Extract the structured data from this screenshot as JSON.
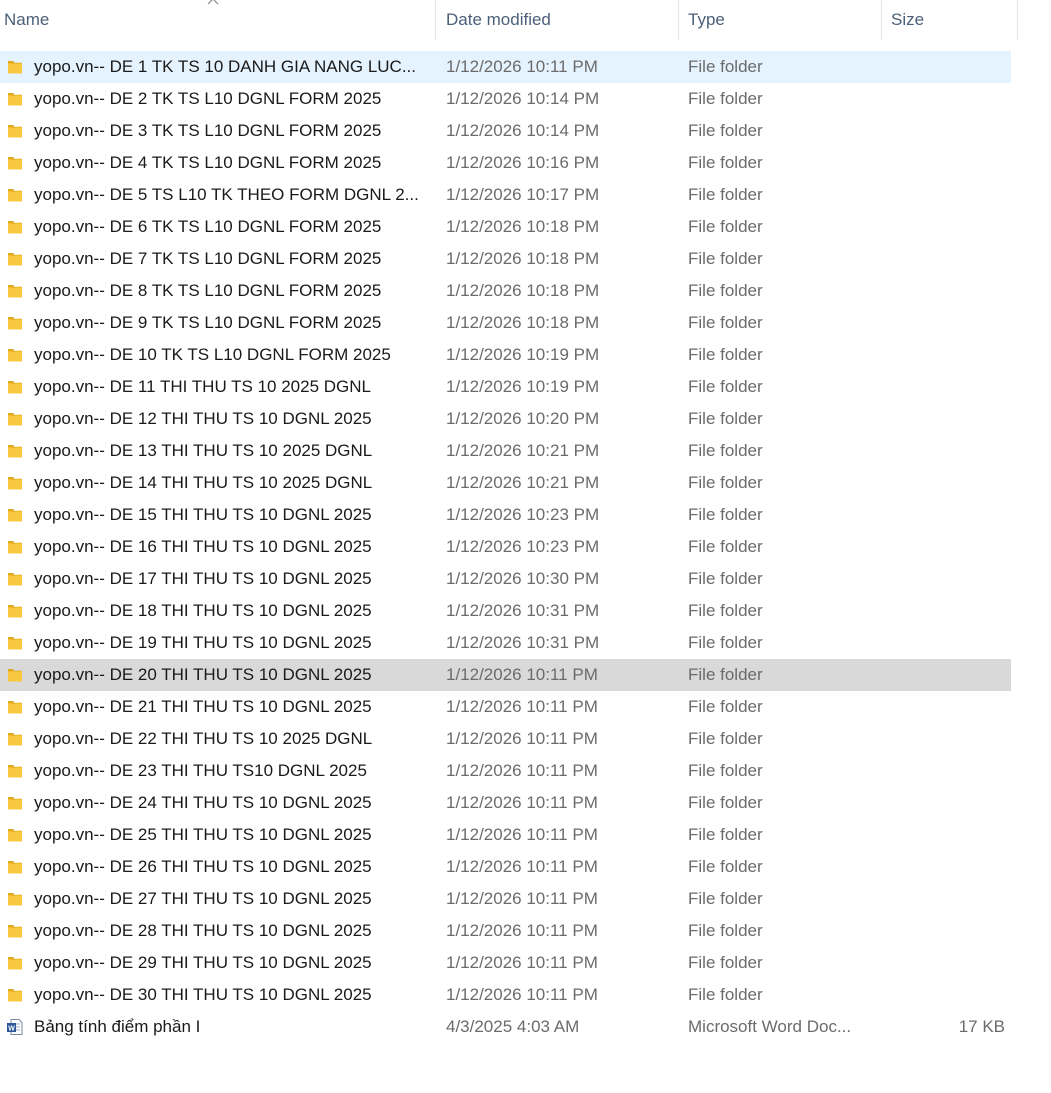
{
  "columns": {
    "name": "Name",
    "date": "Date modified",
    "type": "Type",
    "size": "Size"
  },
  "colors": {
    "selected_bg": "#e5f3ff",
    "hover_bg": "#d9d9d9",
    "folder_yellow": "#f8c840",
    "word_blue": "#2b579a"
  },
  "files": [
    {
      "name": "yopo.vn-- DE 1 TK TS 10 DANH GIA NANG LUC...",
      "date": "1/12/2026 10:11 PM",
      "type": "File folder",
      "size": "",
      "icon": "folder-icon",
      "state": "selected"
    },
    {
      "name": "yopo.vn-- DE 2 TK TS L10 DGNL FORM 2025",
      "date": "1/12/2026 10:14 PM",
      "type": "File folder",
      "size": "",
      "icon": "folder-icon",
      "state": ""
    },
    {
      "name": "yopo.vn-- DE 3 TK TS L10 DGNL FORM 2025",
      "date": "1/12/2026 10:14 PM",
      "type": "File folder",
      "size": "",
      "icon": "folder-icon",
      "state": ""
    },
    {
      "name": "yopo.vn-- DE 4 TK TS L10 DGNL FORM 2025",
      "date": "1/12/2026 10:16 PM",
      "type": "File folder",
      "size": "",
      "icon": "folder-icon",
      "state": ""
    },
    {
      "name": "yopo.vn-- DE 5 TS L10 TK THEO FORM DGNL 2...",
      "date": "1/12/2026 10:17 PM",
      "type": "File folder",
      "size": "",
      "icon": "folder-icon",
      "state": ""
    },
    {
      "name": "yopo.vn-- DE 6 TK TS L10 DGNL FORM 2025",
      "date": "1/12/2026 10:18 PM",
      "type": "File folder",
      "size": "",
      "icon": "folder-icon",
      "state": ""
    },
    {
      "name": "yopo.vn-- DE 7 TK TS L10 DGNL FORM 2025",
      "date": "1/12/2026 10:18 PM",
      "type": "File folder",
      "size": "",
      "icon": "folder-icon",
      "state": ""
    },
    {
      "name": "yopo.vn-- DE 8 TK TS L10 DGNL FORM 2025",
      "date": "1/12/2026 10:18 PM",
      "type": "File folder",
      "size": "",
      "icon": "folder-icon",
      "state": ""
    },
    {
      "name": "yopo.vn-- DE 9 TK TS L10 DGNL FORM 2025",
      "date": "1/12/2026 10:18 PM",
      "type": "File folder",
      "size": "",
      "icon": "folder-icon",
      "state": ""
    },
    {
      "name": "yopo.vn-- DE 10 TK TS L10 DGNL FORM 2025",
      "date": "1/12/2026 10:19 PM",
      "type": "File folder",
      "size": "",
      "icon": "folder-icon",
      "state": ""
    },
    {
      "name": "yopo.vn-- DE 11 THI THU TS 10 2025 DGNL",
      "date": "1/12/2026 10:19 PM",
      "type": "File folder",
      "size": "",
      "icon": "folder-icon",
      "state": ""
    },
    {
      "name": "yopo.vn-- DE 12 THI THU TS 10 DGNL 2025",
      "date": "1/12/2026 10:20 PM",
      "type": "File folder",
      "size": "",
      "icon": "folder-icon",
      "state": ""
    },
    {
      "name": "yopo.vn-- DE 13 THI THU TS 10 2025 DGNL",
      "date": "1/12/2026 10:21 PM",
      "type": "File folder",
      "size": "",
      "icon": "folder-icon",
      "state": ""
    },
    {
      "name": "yopo.vn-- DE 14 THI THU TS 10 2025 DGNL",
      "date": "1/12/2026 10:21 PM",
      "type": "File folder",
      "size": "",
      "icon": "folder-icon",
      "state": ""
    },
    {
      "name": "yopo.vn-- DE 15 THI THU TS 10 DGNL 2025",
      "date": "1/12/2026 10:23 PM",
      "type": "File folder",
      "size": "",
      "icon": "folder-icon",
      "state": ""
    },
    {
      "name": "yopo.vn-- DE 16 THI THU TS 10 DGNL 2025",
      "date": "1/12/2026 10:23 PM",
      "type": "File folder",
      "size": "",
      "icon": "folder-icon",
      "state": ""
    },
    {
      "name": "yopo.vn-- DE 17 THI THU TS 10 DGNL 2025",
      "date": "1/12/2026 10:30 PM",
      "type": "File folder",
      "size": "",
      "icon": "folder-icon",
      "state": ""
    },
    {
      "name": "yopo.vn-- DE 18 THI THU TS 10 DGNL 2025",
      "date": "1/12/2026 10:31 PM",
      "type": "File folder",
      "size": "",
      "icon": "folder-icon",
      "state": ""
    },
    {
      "name": "yopo.vn-- DE 19 THI THU TS 10 DGNL 2025",
      "date": "1/12/2026 10:31 PM",
      "type": "File folder",
      "size": "",
      "icon": "folder-icon",
      "state": ""
    },
    {
      "name": "yopo.vn-- DE 20 THI THU TS 10 DGNL 2025",
      "date": "1/12/2026 10:11 PM",
      "type": "File folder",
      "size": "",
      "icon": "folder-icon",
      "state": "hovered"
    },
    {
      "name": "yopo.vn-- DE 21 THI THU TS 10 DGNL 2025",
      "date": "1/12/2026 10:11 PM",
      "type": "File folder",
      "size": "",
      "icon": "folder-icon",
      "state": ""
    },
    {
      "name": "yopo.vn-- DE 22 THI THU TS 10 2025 DGNL",
      "date": "1/12/2026 10:11 PM",
      "type": "File folder",
      "size": "",
      "icon": "folder-icon",
      "state": ""
    },
    {
      "name": "yopo.vn-- DE 23 THI THU TS10 DGNL 2025",
      "date": "1/12/2026 10:11 PM",
      "type": "File folder",
      "size": "",
      "icon": "folder-icon",
      "state": ""
    },
    {
      "name": "yopo.vn-- DE 24 THI THU TS 10 DGNL 2025",
      "date": "1/12/2026 10:11 PM",
      "type": "File folder",
      "size": "",
      "icon": "folder-icon",
      "state": ""
    },
    {
      "name": "yopo.vn-- DE 25 THI THU TS 10 DGNL 2025",
      "date": "1/12/2026 10:11 PM",
      "type": "File folder",
      "size": "",
      "icon": "folder-icon",
      "state": ""
    },
    {
      "name": "yopo.vn-- DE 26 THI THU TS 10 DGNL 2025",
      "date": "1/12/2026 10:11 PM",
      "type": "File folder",
      "size": "",
      "icon": "folder-icon",
      "state": ""
    },
    {
      "name": "yopo.vn-- DE 27 THI THU TS 10 DGNL 2025",
      "date": "1/12/2026 10:11 PM",
      "type": "File folder",
      "size": "",
      "icon": "folder-icon",
      "state": ""
    },
    {
      "name": "yopo.vn-- DE 28 THI THU TS 10 DGNL 2025",
      "date": "1/12/2026 10:11 PM",
      "type": "File folder",
      "size": "",
      "icon": "folder-icon",
      "state": ""
    },
    {
      "name": "yopo.vn-- DE 29 THI THU TS 10 DGNL 2025",
      "date": "1/12/2026 10:11 PM",
      "type": "File folder",
      "size": "",
      "icon": "folder-icon",
      "state": ""
    },
    {
      "name": "yopo.vn-- DE 30 THI THU TS 10 DGNL 2025",
      "date": "1/12/2026 10:11 PM",
      "type": "File folder",
      "size": "",
      "icon": "folder-icon",
      "state": ""
    },
    {
      "name": "Bảng tính điểm phần I",
      "date": "4/3/2025 4:03 AM",
      "type": "Microsoft Word Doc...",
      "size": "17 KB",
      "icon": "word-document-icon",
      "state": ""
    }
  ]
}
